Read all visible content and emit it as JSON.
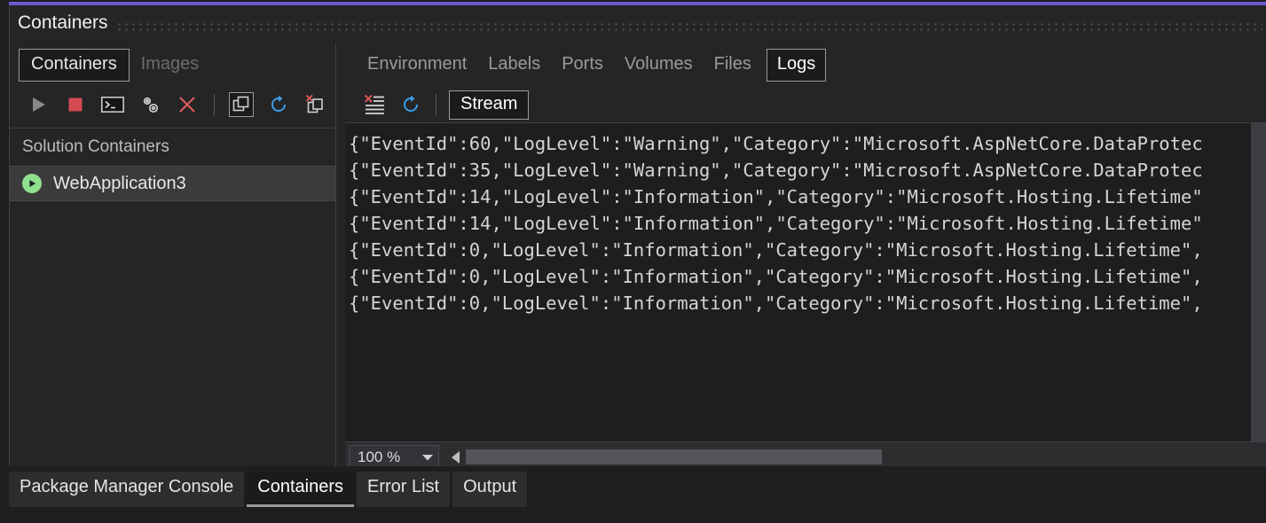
{
  "window": {
    "title": "Containers",
    "accent_color": "#6a5acd"
  },
  "left_panel": {
    "tabs": [
      {
        "label": "Containers",
        "state": "focused"
      },
      {
        "label": "Images",
        "state": "disabled"
      }
    ],
    "toolbar": [
      {
        "name": "start-button",
        "icon": "play-icon",
        "color": "#888888"
      },
      {
        "name": "stop-button",
        "icon": "stop-icon",
        "color": "#d44a52"
      },
      {
        "name": "open-terminal-button",
        "icon": "terminal-icon",
        "color": "#cccccc"
      },
      {
        "name": "settings-button",
        "icon": "gears-icon",
        "color": "#cccccc"
      },
      {
        "name": "remove-button",
        "icon": "close-x-icon",
        "color": "#e05b5b"
      },
      {
        "name": "toolbar-separator",
        "icon": "separator",
        "color": "#5a5a5a"
      },
      {
        "name": "view-containers-button",
        "icon": "stack-icon",
        "color": "#cccccc"
      },
      {
        "name": "refresh-button",
        "icon": "refresh-icon",
        "color": "#3b9fe8"
      },
      {
        "name": "prune-containers-button",
        "icon": "stack-delete-icon",
        "color": "#cccccc"
      }
    ],
    "group_header": "Solution Containers",
    "items": [
      {
        "label": "WebApplication3",
        "status": "running",
        "status_color": "#8fe08f"
      }
    ]
  },
  "right_panel": {
    "tabs": [
      {
        "label": "Environment",
        "selected": false
      },
      {
        "label": "Labels",
        "selected": false
      },
      {
        "label": "Ports",
        "selected": false
      },
      {
        "label": "Volumes",
        "selected": false
      },
      {
        "label": "Files",
        "selected": false
      },
      {
        "label": "Logs",
        "selected": true
      }
    ],
    "toolbar": [
      {
        "name": "clear-logs-button",
        "icon": "clear-list-icon"
      },
      {
        "name": "refresh-logs-button",
        "icon": "refresh-icon"
      }
    ],
    "stream_button_label": "Stream",
    "log_lines": [
      "{\"EventId\":60,\"LogLevel\":\"Warning\",\"Category\":\"Microsoft.AspNetCore.DataProtec",
      "{\"EventId\":35,\"LogLevel\":\"Warning\",\"Category\":\"Microsoft.AspNetCore.DataProtec",
      "{\"EventId\":14,\"LogLevel\":\"Information\",\"Category\":\"Microsoft.Hosting.Lifetime\"",
      "{\"EventId\":14,\"LogLevel\":\"Information\",\"Category\":\"Microsoft.Hosting.Lifetime\"",
      "{\"EventId\":0,\"LogLevel\":\"Information\",\"Category\":\"Microsoft.Hosting.Lifetime\",",
      "{\"EventId\":0,\"LogLevel\":\"Information\",\"Category\":\"Microsoft.Hosting.Lifetime\",",
      "{\"EventId\":0,\"LogLevel\":\"Information\",\"Category\":\"Microsoft.Hosting.Lifetime\","
    ],
    "status": {
      "zoom_level": "100 %"
    }
  },
  "bottom_tabs": [
    {
      "label": "Package Manager Console",
      "active": false
    },
    {
      "label": "Containers",
      "active": true
    },
    {
      "label": "Error List",
      "active": false
    },
    {
      "label": "Output",
      "active": false
    }
  ]
}
